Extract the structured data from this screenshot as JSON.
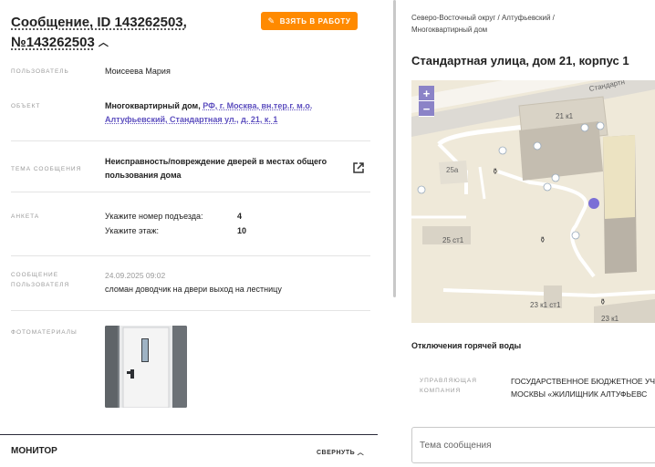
{
  "request": {
    "title": "Сообщение, ID 143262503, №143262503",
    "take_button": "ВЗЯТЬ В РАБОТУ"
  },
  "fields": {
    "user_label": "ПОЛЬЗОВАТЕЛЬ",
    "user_value": "Моисеева Мария",
    "object_label": "ОБЪЕКТ",
    "object_type": "Многоквартирный дом,",
    "object_address": "РФ, г. Москва, вн.тер.г. м.о. Алтуфьевский, Стандартная ул., д. 21, к. 1",
    "topic_label": "ТЕМА СООБЩЕНИЯ",
    "topic_value": "Неисправность/повреждение дверей в местах общего пользования дома",
    "form_label": "АНКЕТА",
    "form_q1": "Укажите номер подъезда:",
    "form_a1": "4",
    "form_q2": "Укажите этаж:",
    "form_a2": "10",
    "message_label": "СООБЩЕНИЕ ПОЛЬЗОВАТЕЛЯ",
    "message_date": "24.09.2025 09:02",
    "message_text": "сломан доводчик на двери выход на лестницу",
    "photos_label": "ФОТОМАТЕРИАЛЫ"
  },
  "monitor": {
    "title": "МОНИТОР",
    "collapse_label": "СВЕРНУТЬ"
  },
  "location": {
    "breadcrumb": "Северо-Восточный округ / Алтуфьевский / Многоквартирный дом",
    "address": "Стандартная улица, дом 21, корпус 1",
    "map_labels": {
      "b1": "21 к1",
      "b2": "25а",
      "b3": "25 ст1",
      "b4": "23 к1 ст1",
      "b5": "23 к1",
      "street": "Стандартн"
    },
    "hot_water": "Отключения горячей воды",
    "mc_label": "УПРАВЛЯЮЩАЯ КОМПАНИЯ",
    "mc_value_line1": "ГОСУДАРСТВЕННОЕ БЮДЖЕТНОЕ УЧ",
    "mc_value_line2": "МОСКВЫ «ЖИЛИЩНИК АЛТУФЬЕВС",
    "subject_placeholder": "Тема сообщения"
  },
  "colors": {
    "accent": "#ff8a00",
    "link": "#5d4fbf",
    "map_marker": "#7b6fd6"
  }
}
